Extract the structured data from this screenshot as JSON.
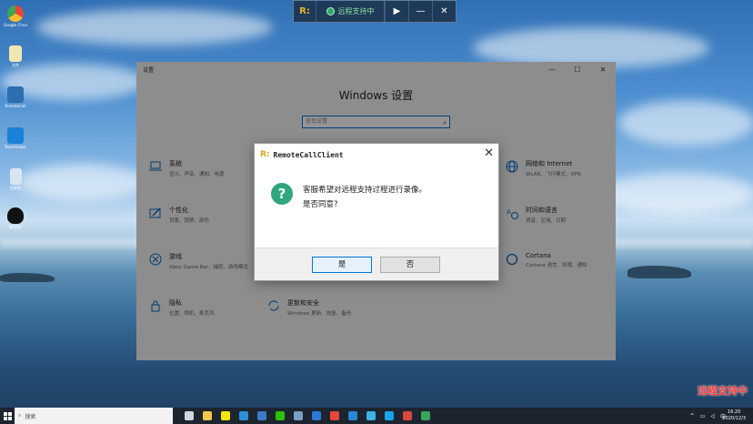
{
  "desktop": {
    "icons": [
      {
        "label": "Google Chrome",
        "icon": "chrome-icon",
        "color": "#e8453c"
      },
      {
        "label": "文件",
        "icon": "file-icon",
        "color": "#f0e6b2"
      },
      {
        "label": "RemoteCall",
        "icon": "remotecall-icon",
        "color": "#2b6fb0"
      },
      {
        "label": "TeamViewer",
        "icon": "teamviewer-icon",
        "color": "#1a82d6"
      },
      {
        "label": "回收站",
        "icon": "recycle-bin-icon",
        "color": "#d9e6f2"
      },
      {
        "label": "腾讯QQ",
        "icon": "qq-icon",
        "color": "#111111"
      }
    ]
  },
  "remote_bar": {
    "logo": "R:",
    "status": "远程支持中",
    "play": "▶",
    "minimize": "—",
    "close": "✕"
  },
  "settings": {
    "title": "设置",
    "heading": "Windows 设置",
    "search_placeholder": "查找设置",
    "minimize": "—",
    "maximize": "☐",
    "close": "✕",
    "tiles": [
      {
        "title": "系统",
        "sub": "显示、声音、通知、电源",
        "icon": "laptop-icon"
      },
      {
        "title": "网络和 Internet",
        "sub": "WLAN、飞行模式、VPN",
        "icon": "globe-icon"
      },
      {
        "title": "个性化",
        "sub": "背景、锁屏、颜色",
        "icon": "brush-icon"
      },
      {
        "title": "时间和语言",
        "sub": "语音、区域、日期",
        "icon": "time-language-icon"
      },
      {
        "title": "游戏",
        "sub": "Xbox Game Bar、捕获、游戏模式",
        "icon": "xbox-icon"
      },
      {
        "title": "Cortana",
        "sub": "Cortana 语言、权限、通知",
        "icon": "cortana-icon"
      },
      {
        "title": "隐私",
        "sub": "位置、相机、麦克风",
        "icon": "lock-icon"
      },
      {
        "title": "更新和安全",
        "sub": "Windows 更新、恢复、备份",
        "icon": "update-icon"
      }
    ]
  },
  "dialog": {
    "logo": "R:",
    "title": "RemoteCallClient",
    "close": "✕",
    "message_line1": "客服希望对远程支持过程进行录像。",
    "message_line2": "是否同意?",
    "yes_label": "是",
    "no_label": "否"
  },
  "watermark": "远程支持中",
  "taskbar": {
    "search_placeholder": "搜索",
    "apps": [
      {
        "icon": "task-view-icon",
        "color": "#cfd6de"
      },
      {
        "icon": "folder-icon",
        "color": "#f2c84b"
      },
      {
        "icon": "kakaotalk-icon",
        "color": "#f7e600"
      },
      {
        "icon": "ie-icon",
        "color": "#2d8fd5"
      },
      {
        "icon": "remotecall-icon",
        "color": "#3a7cc3"
      },
      {
        "icon": "wechat-icon",
        "color": "#2dc100"
      },
      {
        "icon": "app-icon",
        "color": "#7aa0c4"
      },
      {
        "icon": "thunder-icon",
        "color": "#2b78d6"
      },
      {
        "icon": "chrome-icon",
        "color": "#e8453c"
      },
      {
        "icon": "edge-icon",
        "color": "#2b88d8"
      },
      {
        "icon": "app2-icon",
        "color": "#3cb4e6"
      },
      {
        "icon": "qq-browser-icon",
        "color": "#1aa3e8"
      },
      {
        "icon": "app3-icon",
        "color": "#d94a3d"
      },
      {
        "icon": "app4-icon",
        "color": "#39a35c"
      }
    ],
    "time": "16:20",
    "date": "2020/12/3"
  }
}
